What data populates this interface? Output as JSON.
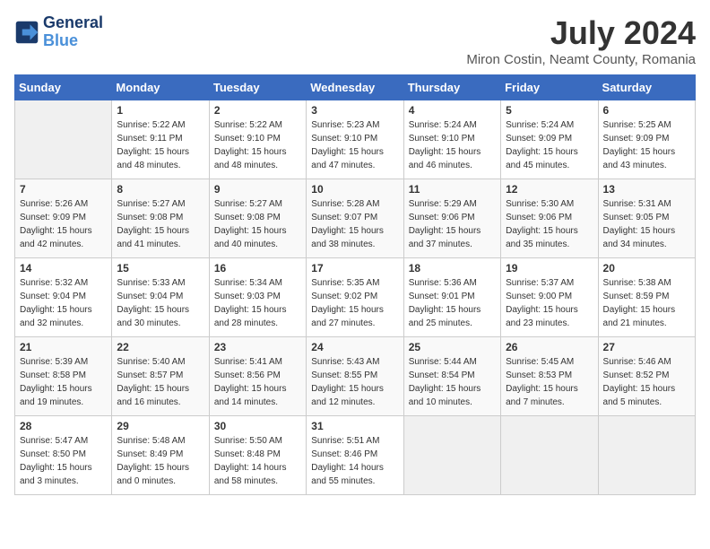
{
  "header": {
    "logo_line1": "General",
    "logo_line2": "Blue",
    "month_year": "July 2024",
    "location": "Miron Costin, Neamt County, Romania"
  },
  "weekdays": [
    "Sunday",
    "Monday",
    "Tuesday",
    "Wednesday",
    "Thursday",
    "Friday",
    "Saturday"
  ],
  "weeks": [
    [
      {
        "day": "",
        "info": ""
      },
      {
        "day": "1",
        "info": "Sunrise: 5:22 AM\nSunset: 9:11 PM\nDaylight: 15 hours\nand 48 minutes."
      },
      {
        "day": "2",
        "info": "Sunrise: 5:22 AM\nSunset: 9:10 PM\nDaylight: 15 hours\nand 48 minutes."
      },
      {
        "day": "3",
        "info": "Sunrise: 5:23 AM\nSunset: 9:10 PM\nDaylight: 15 hours\nand 47 minutes."
      },
      {
        "day": "4",
        "info": "Sunrise: 5:24 AM\nSunset: 9:10 PM\nDaylight: 15 hours\nand 46 minutes."
      },
      {
        "day": "5",
        "info": "Sunrise: 5:24 AM\nSunset: 9:09 PM\nDaylight: 15 hours\nand 45 minutes."
      },
      {
        "day": "6",
        "info": "Sunrise: 5:25 AM\nSunset: 9:09 PM\nDaylight: 15 hours\nand 43 minutes."
      }
    ],
    [
      {
        "day": "7",
        "info": "Sunrise: 5:26 AM\nSunset: 9:09 PM\nDaylight: 15 hours\nand 42 minutes."
      },
      {
        "day": "8",
        "info": "Sunrise: 5:27 AM\nSunset: 9:08 PM\nDaylight: 15 hours\nand 41 minutes."
      },
      {
        "day": "9",
        "info": "Sunrise: 5:27 AM\nSunset: 9:08 PM\nDaylight: 15 hours\nand 40 minutes."
      },
      {
        "day": "10",
        "info": "Sunrise: 5:28 AM\nSunset: 9:07 PM\nDaylight: 15 hours\nand 38 minutes."
      },
      {
        "day": "11",
        "info": "Sunrise: 5:29 AM\nSunset: 9:06 PM\nDaylight: 15 hours\nand 37 minutes."
      },
      {
        "day": "12",
        "info": "Sunrise: 5:30 AM\nSunset: 9:06 PM\nDaylight: 15 hours\nand 35 minutes."
      },
      {
        "day": "13",
        "info": "Sunrise: 5:31 AM\nSunset: 9:05 PM\nDaylight: 15 hours\nand 34 minutes."
      }
    ],
    [
      {
        "day": "14",
        "info": "Sunrise: 5:32 AM\nSunset: 9:04 PM\nDaylight: 15 hours\nand 32 minutes."
      },
      {
        "day": "15",
        "info": "Sunrise: 5:33 AM\nSunset: 9:04 PM\nDaylight: 15 hours\nand 30 minutes."
      },
      {
        "day": "16",
        "info": "Sunrise: 5:34 AM\nSunset: 9:03 PM\nDaylight: 15 hours\nand 28 minutes."
      },
      {
        "day": "17",
        "info": "Sunrise: 5:35 AM\nSunset: 9:02 PM\nDaylight: 15 hours\nand 27 minutes."
      },
      {
        "day": "18",
        "info": "Sunrise: 5:36 AM\nSunset: 9:01 PM\nDaylight: 15 hours\nand 25 minutes."
      },
      {
        "day": "19",
        "info": "Sunrise: 5:37 AM\nSunset: 9:00 PM\nDaylight: 15 hours\nand 23 minutes."
      },
      {
        "day": "20",
        "info": "Sunrise: 5:38 AM\nSunset: 8:59 PM\nDaylight: 15 hours\nand 21 minutes."
      }
    ],
    [
      {
        "day": "21",
        "info": "Sunrise: 5:39 AM\nSunset: 8:58 PM\nDaylight: 15 hours\nand 19 minutes."
      },
      {
        "day": "22",
        "info": "Sunrise: 5:40 AM\nSunset: 8:57 PM\nDaylight: 15 hours\nand 16 minutes."
      },
      {
        "day": "23",
        "info": "Sunrise: 5:41 AM\nSunset: 8:56 PM\nDaylight: 15 hours\nand 14 minutes."
      },
      {
        "day": "24",
        "info": "Sunrise: 5:43 AM\nSunset: 8:55 PM\nDaylight: 15 hours\nand 12 minutes."
      },
      {
        "day": "25",
        "info": "Sunrise: 5:44 AM\nSunset: 8:54 PM\nDaylight: 15 hours\nand 10 minutes."
      },
      {
        "day": "26",
        "info": "Sunrise: 5:45 AM\nSunset: 8:53 PM\nDaylight: 15 hours\nand 7 minutes."
      },
      {
        "day": "27",
        "info": "Sunrise: 5:46 AM\nSunset: 8:52 PM\nDaylight: 15 hours\nand 5 minutes."
      }
    ],
    [
      {
        "day": "28",
        "info": "Sunrise: 5:47 AM\nSunset: 8:50 PM\nDaylight: 15 hours\nand 3 minutes."
      },
      {
        "day": "29",
        "info": "Sunrise: 5:48 AM\nSunset: 8:49 PM\nDaylight: 15 hours\nand 0 minutes."
      },
      {
        "day": "30",
        "info": "Sunrise: 5:50 AM\nSunset: 8:48 PM\nDaylight: 14 hours\nand 58 minutes."
      },
      {
        "day": "31",
        "info": "Sunrise: 5:51 AM\nSunset: 8:46 PM\nDaylight: 14 hours\nand 55 minutes."
      },
      {
        "day": "",
        "info": ""
      },
      {
        "day": "",
        "info": ""
      },
      {
        "day": "",
        "info": ""
      }
    ]
  ]
}
